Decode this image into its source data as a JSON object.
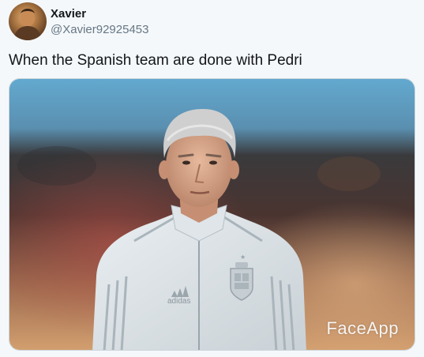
{
  "tweet": {
    "author": {
      "display_name": "Xavier",
      "handle": "@Xavier92925453"
    },
    "text": "When the Spanish team are done with Pedri",
    "media": {
      "watermark": "FaceApp",
      "shirt_brand": "adidas"
    }
  }
}
